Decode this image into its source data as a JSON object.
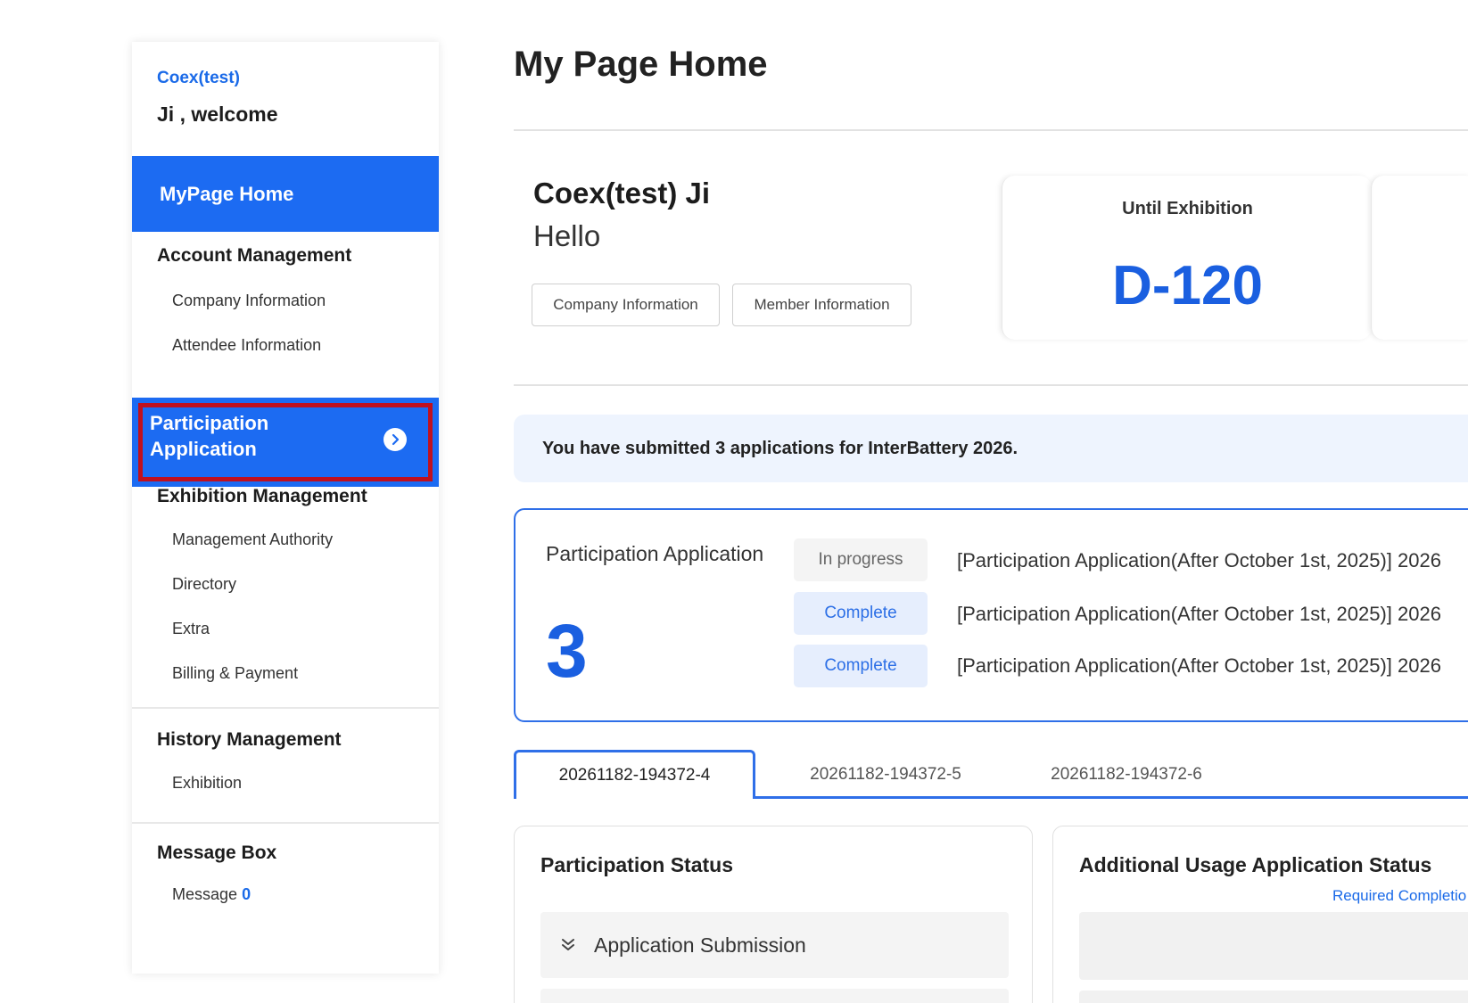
{
  "sidebar": {
    "company": "Coex(test)",
    "welcome": "Ji , welcome",
    "home_label": "MyPage Home",
    "account": {
      "heading": "Account Management",
      "items": [
        "Company Information",
        "Attendee Information"
      ]
    },
    "participation_label": "Participation Application",
    "exhibition": {
      "heading": "Exhibition Management",
      "items": [
        "Management Authority",
        "Directory",
        "Extra",
        "Billing & Payment"
      ]
    },
    "history": {
      "heading": "History Management",
      "items": [
        "Exhibition"
      ]
    },
    "messages": {
      "heading": "Message Box",
      "item_label": "Message",
      "count": "0"
    }
  },
  "main": {
    "title": "My Page Home",
    "greeting": {
      "name": "Coex(test) Ji",
      "hello": "Hello",
      "company_button": "Company Information",
      "member_button": "Member Information"
    },
    "dday": {
      "label": "Until Exhibition",
      "value": "D-120"
    },
    "notice": "You have submitted 3 applications for InterBattery 2026.",
    "applications": {
      "title": "Participation Application",
      "count": "3",
      "rows": [
        {
          "status": "In progress",
          "text": "[Participation Application(After October 1st, 2025)] 2026"
        },
        {
          "status": "Complete",
          "text": "[Participation Application(After October 1st, 2025)] 2026"
        },
        {
          "status": "Complete",
          "text": "[Participation Application(After October 1st, 2025)] 2026"
        }
      ]
    },
    "tabs": [
      "20261182-194372-4",
      "20261182-194372-5",
      "20261182-194372-6"
    ],
    "participation_status": {
      "title": "Participation Status",
      "row_label": "Application Submission"
    },
    "additional_status": {
      "title": "Additional Usage Application Status",
      "link": "Required Completio"
    }
  },
  "colors": {
    "primary": "#1c6bf2",
    "highlight_border": "#c0101e",
    "accent_text": "#1a5fe0"
  }
}
